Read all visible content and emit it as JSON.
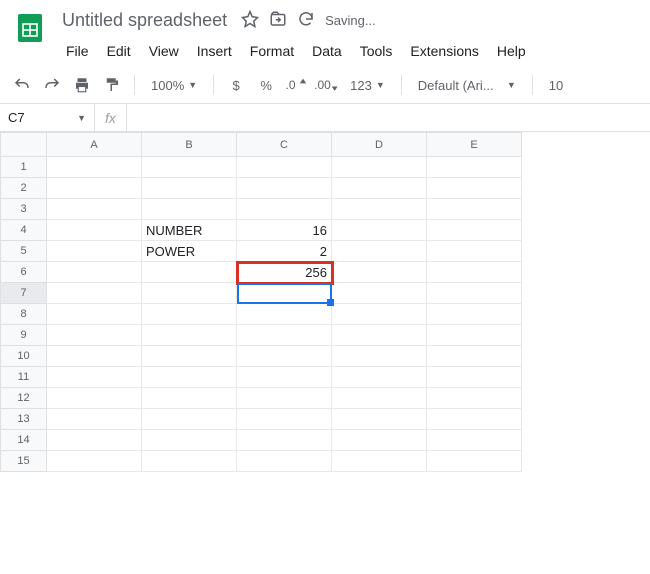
{
  "header": {
    "title": "Untitled spreadsheet",
    "saving": "Saving..."
  },
  "menubar": [
    "File",
    "Edit",
    "View",
    "Insert",
    "Format",
    "Data",
    "Tools",
    "Extensions",
    "Help"
  ],
  "toolbar": {
    "zoom": "100%",
    "currency": "$",
    "percent": "%",
    "dec_dec": ".0",
    "inc_dec": ".00",
    "numfmt": "123",
    "font": "Default (Ari...",
    "fontsize": "10"
  },
  "namebox": "C7",
  "formula": "",
  "columns": [
    "A",
    "B",
    "C",
    "D",
    "E"
  ],
  "rows": [
    "1",
    "2",
    "3",
    "4",
    "5",
    "6",
    "7",
    "8",
    "9",
    "10",
    "11",
    "12",
    "13",
    "14",
    "15"
  ],
  "cells": {
    "B4": "NUMBER",
    "C4": "16",
    "B5": "POWER",
    "C5": "2",
    "C6": "256"
  },
  "fx_label": "fx"
}
